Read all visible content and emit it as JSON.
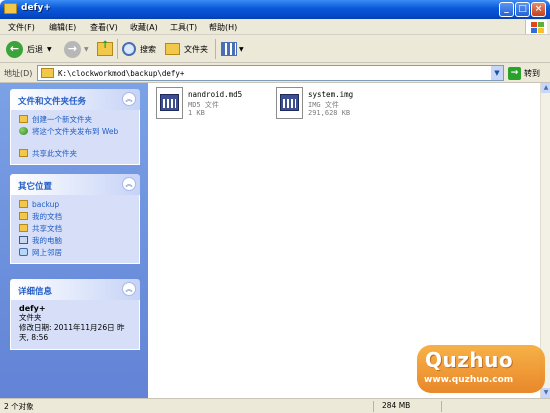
{
  "window": {
    "title": "defy+"
  },
  "menu": {
    "items": [
      "文件(F)",
      "编辑(E)",
      "查看(V)",
      "收藏(A)",
      "工具(T)",
      "帮助(H)"
    ]
  },
  "toolbar": {
    "back": "后退",
    "search": "搜索",
    "folders": "文件夹"
  },
  "address": {
    "label": "地址(D)",
    "path": "K:\\clockworkmod\\backup\\defy+",
    "go": "转到"
  },
  "tasks_panel": {
    "title": "文件和文件夹任务",
    "items": [
      "创建一个新文件夹",
      "将这个文件夹发布到 Web",
      "共享此文件夹"
    ]
  },
  "places_panel": {
    "title": "其它位置",
    "items": [
      "backup",
      "我的文档",
      "共享文档",
      "我的电脑",
      "网上邻居"
    ]
  },
  "details_panel": {
    "title": "详细信息",
    "name": "defy+",
    "type": "文件夹",
    "modified": "修改日期: 2011年11月26日 昨天, 8:56"
  },
  "files": [
    {
      "name": "nandroid.md5",
      "type": "MD5 文件",
      "size": "1 KB"
    },
    {
      "name": "system.img",
      "type": "IMG 文件",
      "size": "291,628 KB"
    }
  ],
  "status": {
    "count": "2 个对象",
    "size": "284 MB"
  },
  "watermark": {
    "brand": "Quzhuo",
    "url": "www.quzhuo.com"
  }
}
